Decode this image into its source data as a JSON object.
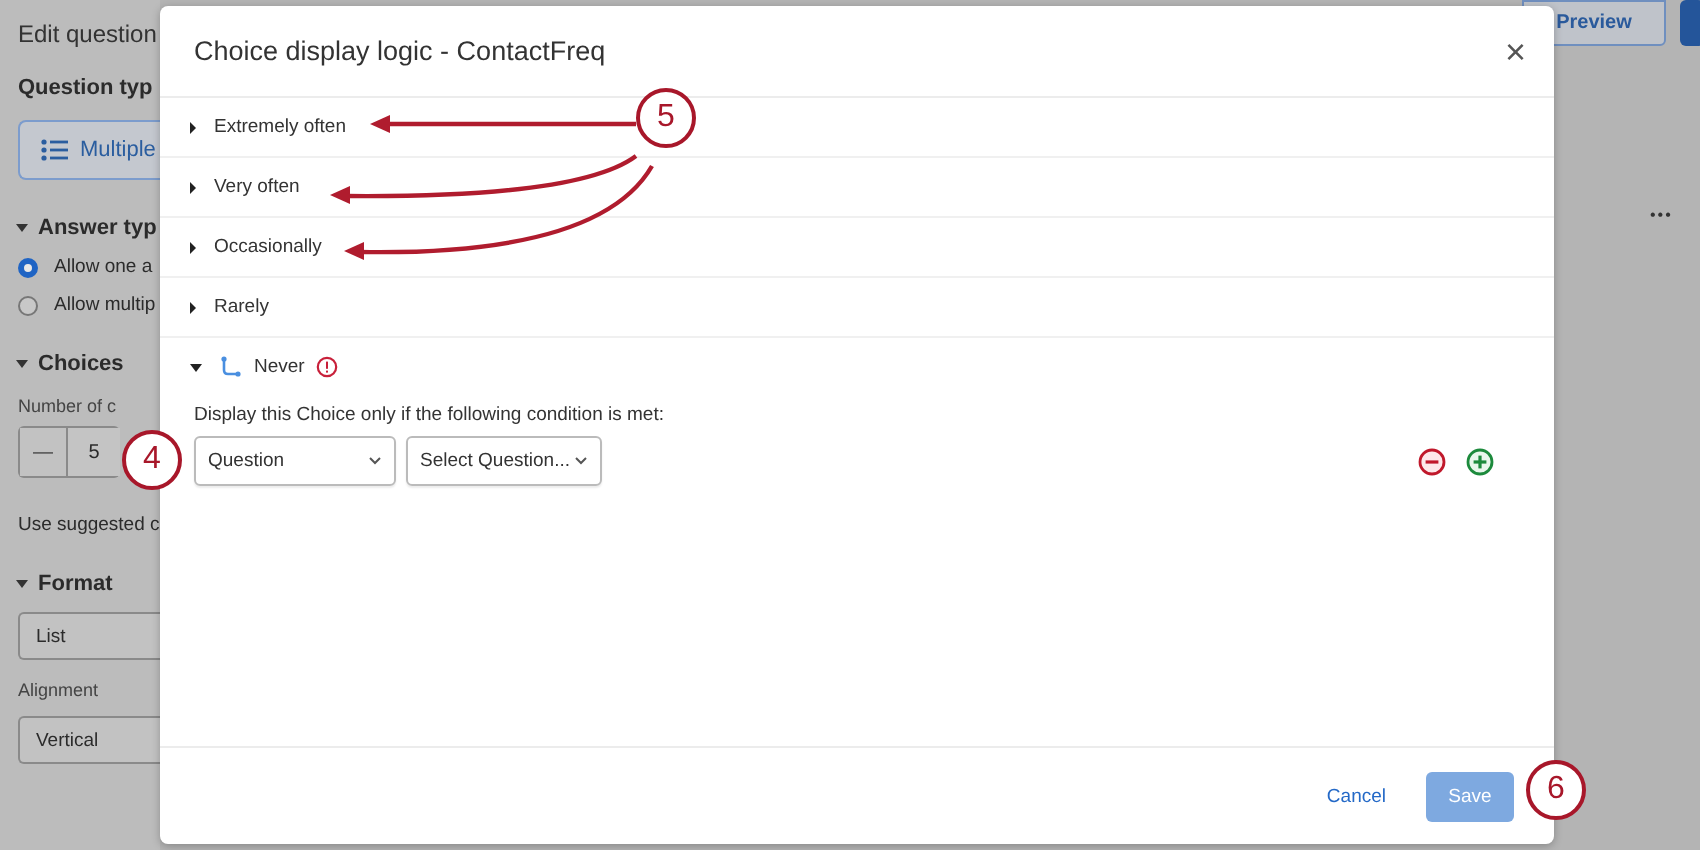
{
  "background": {
    "panel_title": "Edit question",
    "question_type_label": "Question typ",
    "question_type_value": "Multiple",
    "sections": [
      {
        "title": "Answer typ",
        "kind": "radios",
        "options": [
          {
            "label": "Allow one a",
            "selected": true
          },
          {
            "label": "Allow multip",
            "selected": false
          }
        ]
      },
      {
        "title": "Choices",
        "kind": "stepper",
        "label": "Number of c",
        "decrement": "—",
        "value": "5",
        "note": "Use suggested c"
      },
      {
        "title": "Format",
        "kind": "selects",
        "value": "List",
        "label": "Alignment",
        "value2": "Vertical"
      }
    ],
    "preview_button": "Preview",
    "more": "•••"
  },
  "dialog": {
    "title": "Choice display logic - ContactFreq",
    "close": "×",
    "choices": [
      {
        "label": "Extremely often",
        "expanded": false,
        "has_logic": false,
        "warning": false
      },
      {
        "label": "Very often",
        "expanded": false,
        "has_logic": false,
        "warning": false
      },
      {
        "label": "Occasionally",
        "expanded": false,
        "has_logic": false,
        "warning": false
      },
      {
        "label": "Rarely",
        "expanded": false,
        "has_logic": false,
        "warning": false
      },
      {
        "label": "Never",
        "expanded": true,
        "has_logic": true,
        "warning": true
      }
    ],
    "condition": {
      "text": "Display this Choice only if the following condition is met:",
      "selects": [
        "Question",
        "Select Question..."
      ]
    },
    "buttons": [
      {
        "label": "Cancel",
        "kind": "link",
        "disabled": false
      },
      {
        "label": "Save",
        "kind": "primary",
        "disabled": true
      }
    ]
  },
  "callouts": [
    {
      "number": "5"
    },
    {
      "number": "4"
    },
    {
      "number": "6"
    }
  ]
}
